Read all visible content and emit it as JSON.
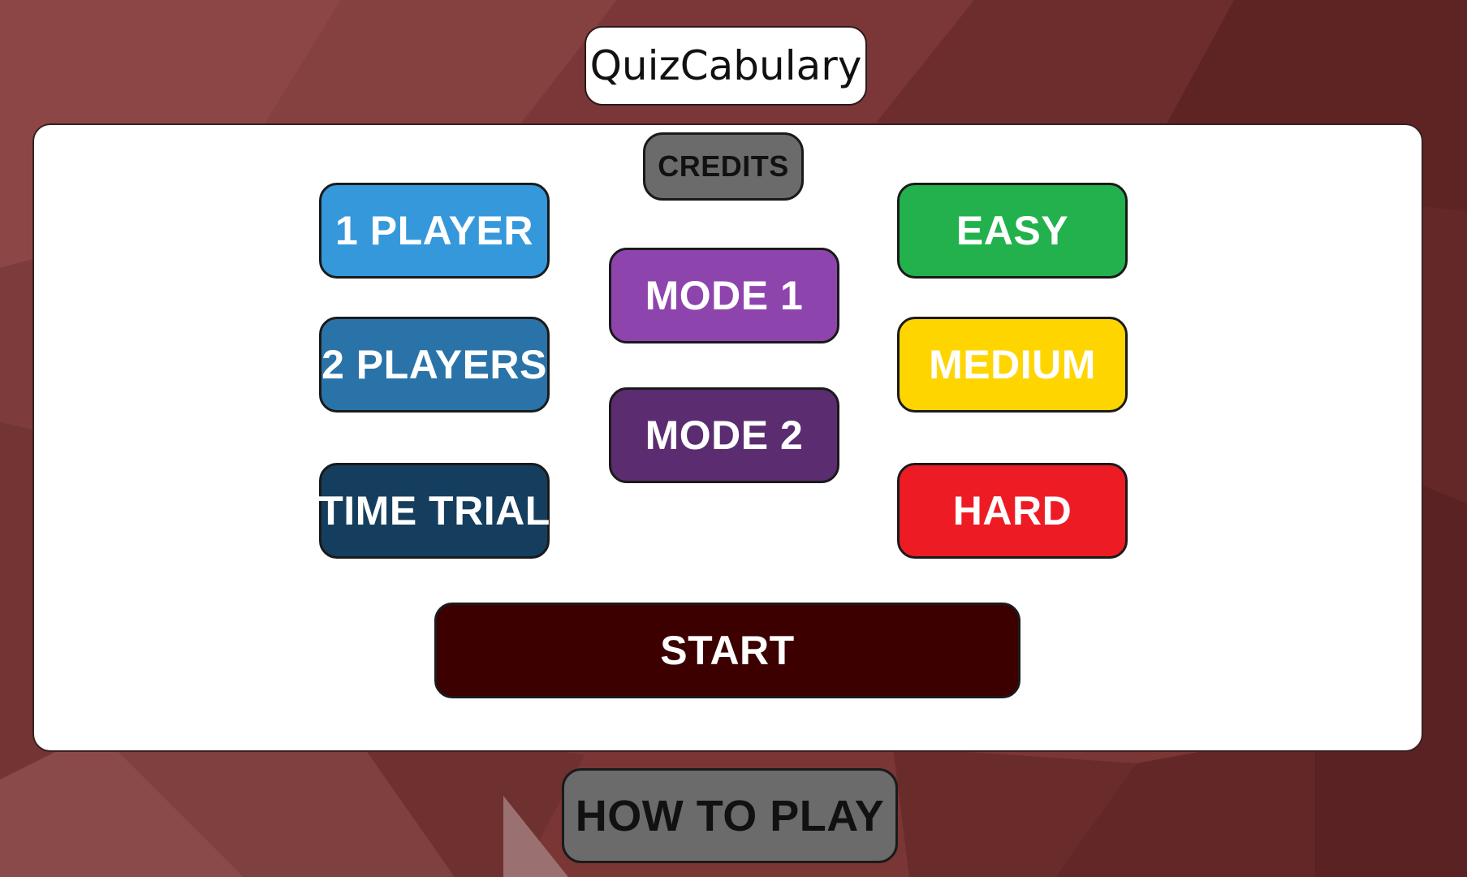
{
  "app": {
    "title": "QuizCabulary"
  },
  "menu": {
    "credits_label": "CREDITS",
    "player_options": [
      "1 PLAYER",
      "2 PLAYERS",
      "TIME TRIAL"
    ],
    "mode_options": [
      "MODE 1",
      "MODE 2"
    ],
    "difficulty_options": [
      "EASY",
      "MEDIUM",
      "HARD"
    ],
    "start_label": "START",
    "how_to_play_label": "HOW TO PLAY"
  },
  "colors": {
    "background": "#7a3535",
    "one_player": "#3498db",
    "two_players": "#2a73a8",
    "time_trial": "#153e5e",
    "mode_1": "#8e44ad",
    "mode_2": "#5b2c6f",
    "easy": "#22b14c",
    "medium": "#ffd500",
    "hard": "#ed1c24",
    "start": "#3d0000",
    "credits": "#6b6b6b",
    "how_to_play": "#6b6b6b"
  }
}
